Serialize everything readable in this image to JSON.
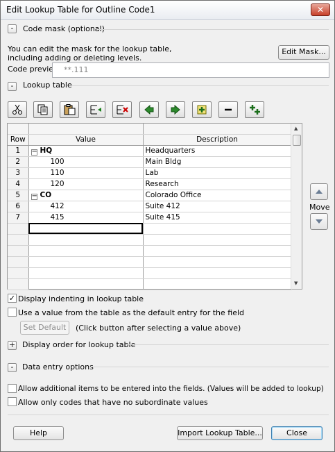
{
  "window": {
    "title": "Edit Lookup Table for Outline Code1",
    "close_label": "✕"
  },
  "code_mask": {
    "toggle": "-",
    "title": "Code mask (optional)",
    "description_line1": "You can edit the mask for the lookup table,",
    "description_line2": "including adding or deleting levels.",
    "edit_mask_button": "Edit Mask...",
    "preview_label": "Code preview:",
    "preview_value": "**.111"
  },
  "lookup_table": {
    "toggle": "-",
    "title": "Lookup table",
    "toolbar_icons": [
      "cut-icon",
      "copy-icon",
      "paste-icon",
      "insert-row-icon",
      "delete-row-icon",
      "outdent-icon",
      "indent-icon",
      "expand-all-icon",
      "collapse-all-icon",
      "show-subtasks-icon"
    ],
    "columns": {
      "row": "Row",
      "value": "Value",
      "description": "Description"
    },
    "rows": [
      {
        "num": "1",
        "value": "HQ",
        "description": "Headquarters",
        "level": 1,
        "outline": "−"
      },
      {
        "num": "2",
        "value": "100",
        "description": "Main Bldg",
        "level": 2
      },
      {
        "num": "3",
        "value": "110",
        "description": "Lab",
        "level": 2
      },
      {
        "num": "4",
        "value": "120",
        "description": "Research",
        "level": 2
      },
      {
        "num": "5",
        "value": "CO",
        "description": "Colorado Office",
        "level": 1,
        "outline": "−"
      },
      {
        "num": "6",
        "value": "412",
        "description": "Suite 412",
        "level": 2
      },
      {
        "num": "7",
        "value": "415",
        "description": "Suite 415",
        "level": 2
      }
    ],
    "move_label": "Move"
  },
  "options": {
    "display_indenting": {
      "label": "Display indenting in lookup table",
      "checked": true
    },
    "use_default": {
      "label": "Use a value from the table as the default entry for the field",
      "checked": false
    },
    "set_default_button": "Set Default",
    "set_default_hint": "(Click button after selecting a value above)"
  },
  "display_order": {
    "toggle": "+",
    "title": "Display order for lookup table"
  },
  "data_entry": {
    "toggle": "-",
    "title": "Data entry options",
    "allow_additional": {
      "label": "Allow additional items to be entered into the fields. (Values will be added to lookup)",
      "checked": false
    },
    "allow_only_codes": {
      "label": "Allow only codes that have no subordinate values",
      "checked": false
    }
  },
  "footer": {
    "help_button": "Help",
    "import_button": "Import Lookup Table...",
    "close_button": "Close"
  }
}
